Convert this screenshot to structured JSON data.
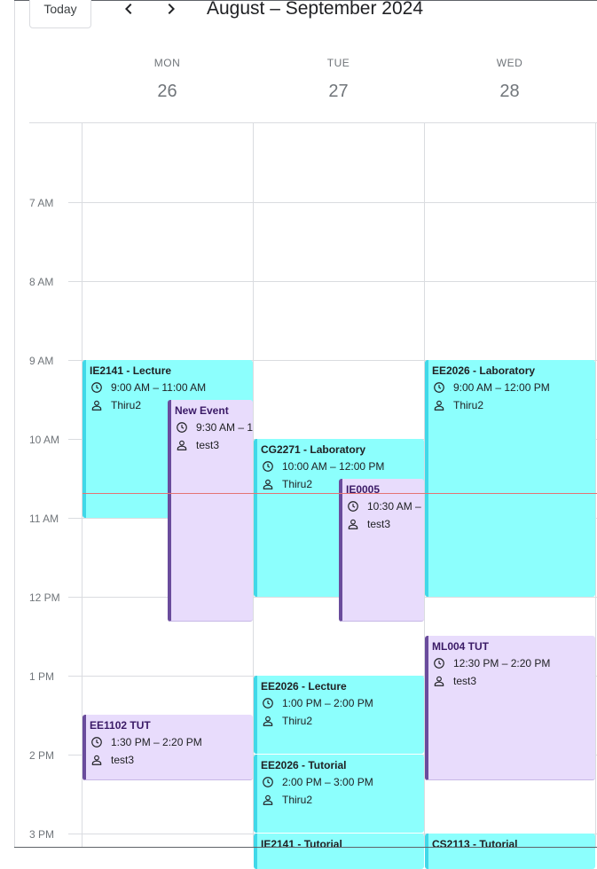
{
  "toolbar": {
    "today_label": "Today",
    "range_title": "August – September 2024"
  },
  "days": [
    {
      "name": "MON",
      "num": "26"
    },
    {
      "name": "TUE",
      "num": "27"
    },
    {
      "name": "WED",
      "num": "28"
    }
  ],
  "hours": [
    "7 AM",
    "8 AM",
    "9 AM",
    "10 AM",
    "11 AM",
    "12 PM",
    "1 PM",
    "2 PM",
    "3 PM"
  ],
  "events": {
    "ie2141_lecture": {
      "title": "IE2141 - Lecture",
      "time": "9:00 AM – 11:00 AM",
      "person": "Thiru2"
    },
    "new_event": {
      "title": "New Event",
      "time": "9:30 AM – 1",
      "person": "test3"
    },
    "ee1102_tut": {
      "title": "EE1102 TUT",
      "time": "1:30 PM – 2:20 PM",
      "person": "test3"
    },
    "cg2271_lab": {
      "title": "CG2271 - Laboratory",
      "time": "10:00 AM – 12:00 PM",
      "person": "Thiru2"
    },
    "ie0005": {
      "title": "IE0005",
      "time": "10:30 AM –",
      "person": "test3"
    },
    "ee2026_lecture": {
      "title": "EE2026 - Lecture",
      "time": "1:00 PM – 2:00 PM",
      "person": "Thiru2"
    },
    "ee2026_tutorial": {
      "title": "EE2026 - Tutorial",
      "time": "2:00 PM – 3:00 PM",
      "person": "Thiru2"
    },
    "ie2141_tutorial": {
      "title": "IE2141 - Tutorial"
    },
    "ee2026_lab": {
      "title": "EE2026 - Laboratory",
      "time": "9:00 AM – 12:00 PM",
      "person": "Thiru2"
    },
    "ml004_tut": {
      "title": "ML004 TUT",
      "time": "12:30 PM – 2:20 PM",
      "person": "test3"
    },
    "cs2113_tutorial": {
      "title": "CS2113 - Tutorial"
    }
  },
  "colors": {
    "class_event": "#8cfffd",
    "personal_event": "#e8dcfc",
    "current_time_line": "#e57373"
  }
}
